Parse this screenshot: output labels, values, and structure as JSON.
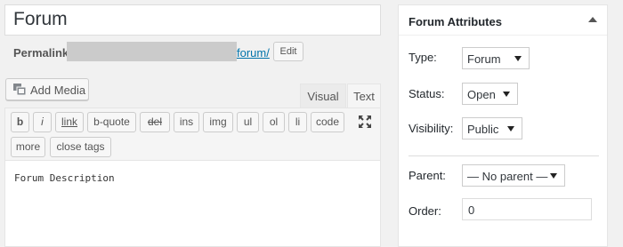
{
  "title": "Forum",
  "permalink": {
    "label": "Permalink:",
    "slug": "forum/",
    "edit_label": "Edit"
  },
  "add_media_label": "Add Media",
  "editor": {
    "tabs": [
      "Visual",
      "Text"
    ],
    "active_tab": "Text",
    "quicktags": [
      "b",
      "i",
      "link",
      "b-quote",
      "del",
      "ins",
      "img",
      "ul",
      "ol",
      "li",
      "code",
      "more",
      "close tags"
    ],
    "content": "Forum Description"
  },
  "attributes": {
    "heading": "Forum Attributes",
    "type_label": "Type:",
    "type_value": "Forum",
    "status_label": "Status:",
    "status_value": "Open",
    "visibility_label": "Visibility:",
    "visibility_value": "Public",
    "parent_label": "Parent:",
    "parent_value": "— No parent —",
    "order_label": "Order:",
    "order_value": "0"
  },
  "icons": {
    "add_media": "media-icon",
    "fullscreen": "fullscreen-icon",
    "collapse": "collapse-arrow-icon"
  },
  "colors": {
    "link": "#0073aa",
    "background": "#f1f1f1"
  }
}
